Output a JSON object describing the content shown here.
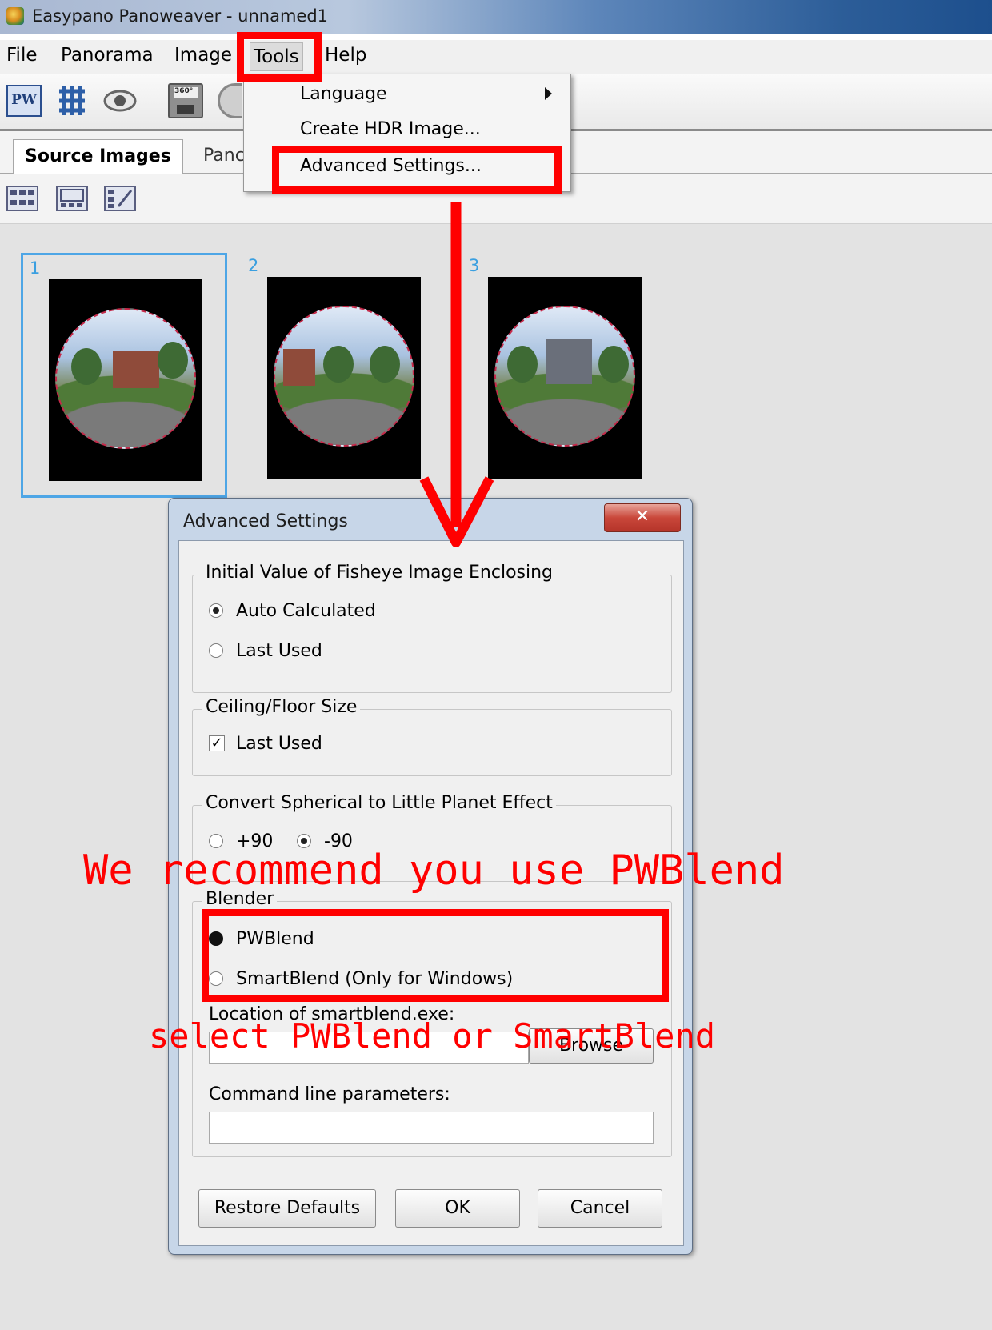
{
  "window": {
    "title": "Easypano Panoweaver - unnamed1"
  },
  "menubar": {
    "items": [
      "File",
      "Panorama",
      "Image",
      "Tools",
      "Help"
    ]
  },
  "toolbar": {
    "pw_label": "PW",
    "save_badge": "360°"
  },
  "tabs": {
    "items": [
      "Source Images",
      "Panc"
    ]
  },
  "thumbnails": [
    {
      "number": "1"
    },
    {
      "number": "2"
    },
    {
      "number": "3"
    }
  ],
  "tools_menu": {
    "items": [
      "Language",
      "Create HDR Image...",
      "Advanced Settings..."
    ]
  },
  "dialog": {
    "title": "Advanced Settings",
    "close_label": "✕",
    "enclosing": {
      "legend": "Initial Value of Fisheye Image Enclosing",
      "options": [
        "Auto Calculated",
        "Last Used"
      ],
      "selected": "Auto Calculated"
    },
    "ceiling": {
      "legend": "Ceiling/Floor Size",
      "checkbox_label": "Last Used",
      "checked": true
    },
    "little_planet": {
      "legend": "Convert Spherical to Little Planet Effect",
      "options": [
        "+90",
        "-90"
      ],
      "selected": "-90"
    },
    "blender": {
      "legend": "Blender",
      "options": [
        "PWBlend",
        "SmartBlend (Only for Windows)"
      ],
      "selected": "PWBlend",
      "location_label": "Location of smartblend.exe:",
      "location_value": "",
      "browse_label": "Browse",
      "params_label": "Command line parameters:",
      "params_value": ""
    },
    "buttons": {
      "restore": "Restore Defaults",
      "ok": "OK",
      "cancel": "Cancel"
    }
  },
  "annotations": {
    "note_recommend": "We recommend you use PWBlend",
    "note_select": "select PWBlend or SmartBlend",
    "color": "#ff0000"
  }
}
